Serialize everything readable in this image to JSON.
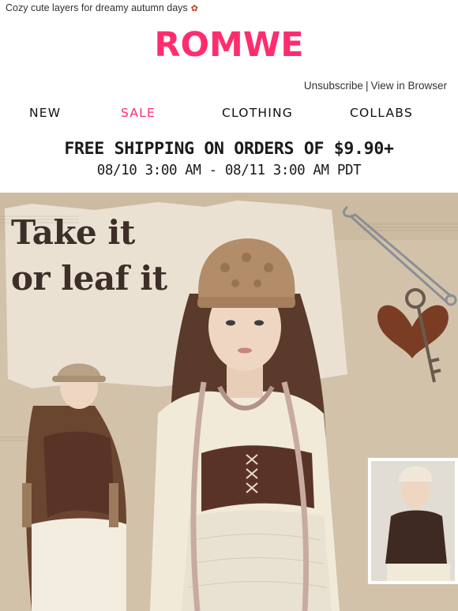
{
  "preheader": {
    "text": "Cozy cute layers for dreamy autumn days",
    "emoji_icon": "maple-leaf-icon"
  },
  "brand": {
    "logo_text": "ROMWE",
    "color": "#ff2d6e"
  },
  "top_links": {
    "unsubscribe": "Unsubscribe",
    "separator": "|",
    "view_in_browser": "View in Browser"
  },
  "nav": {
    "items": [
      {
        "label": "NEW",
        "color": "#111111"
      },
      {
        "label": "SALE",
        "color": "#ff2d6e"
      },
      {
        "label": "CLOTHING",
        "color": "#111111"
      },
      {
        "label": "COLLABS",
        "color": "#111111"
      }
    ]
  },
  "promo": {
    "headline": "FREE SHIPPING ON ORDERS OF $9.90+",
    "dates": "08/10 3:00 AM - 08/11 3:00 AM PDT"
  },
  "hero": {
    "headline_line1": "Take it",
    "headline_line2": "or leaf it",
    "colors": {
      "background": "#d6c8b4",
      "paper": "#e9e1d3",
      "brown": "#5a3327",
      "cream": "#f1ead9",
      "heart": "#7a3d24"
    }
  }
}
